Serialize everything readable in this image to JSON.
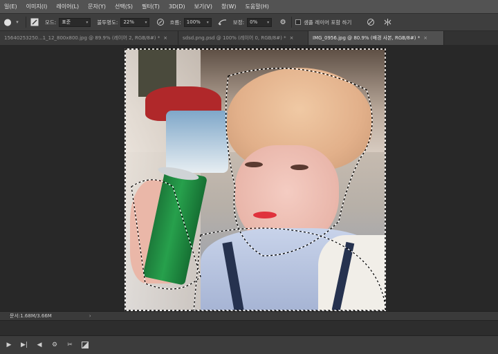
{
  "menubar": {
    "items": [
      "일(E)",
      "이미지(I)",
      "레이어(L)",
      "문자(Y)",
      "선택(S)",
      "필터(T)",
      "3D(D)",
      "보기(V)",
      "창(W)",
      "도움말(H)"
    ]
  },
  "options": {
    "tool_glyph": "●",
    "mode_label": "모드:",
    "mode_value": "표준",
    "opacity_label": "불투명도:",
    "opacity_value": "22%",
    "flow_label": "흐름:",
    "flow_value": "100%",
    "smoothing_label": "보정:",
    "smoothing_value": "0%",
    "sample_label": "샘플 레이어 포함 하기"
  },
  "tabs": [
    {
      "label": "15640253250...1_12_800x800.jpg @ 89.9% (레이어 2, RGB/8#) *",
      "active": false
    },
    {
      "label": "sdsd.png.psd @ 100% (레이어 0, RGB/8#) *",
      "active": false
    },
    {
      "label": "IMG_0956.jpg @ 80.9% (배경 사본, RGB/8#) *",
      "active": true
    }
  ],
  "status": {
    "doc_size": "문서:1.68M/3.66M"
  },
  "icons": {
    "brush_icon": "brush-icon",
    "airbrush_icon": "airbrush-icon",
    "pressure_icon": "pressure-icon",
    "settings_icon": "gear-icon",
    "symmetry_icon": "symmetry-icon"
  },
  "timeline": {
    "buttons": [
      "play-icon",
      "next-frame-icon",
      "audio-icon",
      "settings-icon",
      "scissors-icon",
      "transition-icon"
    ]
  }
}
